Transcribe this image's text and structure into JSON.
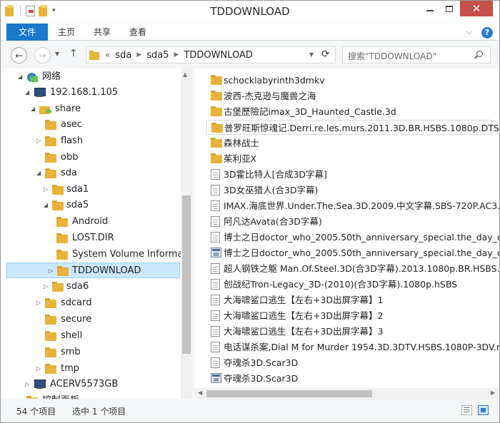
{
  "window": {
    "title": "TDDOWNLOAD"
  },
  "ribbon": {
    "tabs": [
      "文件",
      "主页",
      "共享",
      "查看"
    ],
    "help": "?"
  },
  "nav": {
    "back": "←",
    "forward": "→",
    "up": "↑",
    "breadcrumb_more": "«",
    "breadcrumb": [
      "sda",
      "sda5",
      "TDDOWNLOAD"
    ],
    "refresh": "⟳",
    "search_placeholder": "搜索\"TDDOWNLOAD\""
  },
  "tree": {
    "items": [
      {
        "label": "网络",
        "icon": "network-icon"
      },
      {
        "label": "192.168.1.105",
        "icon": "computer-icon"
      },
      {
        "label": "share",
        "icon": "shared-folder-icon"
      },
      {
        "label": "asec",
        "icon": "folder-icon"
      },
      {
        "label": "flash",
        "icon": "folder-icon"
      },
      {
        "label": "obb",
        "icon": "folder-icon"
      },
      {
        "label": "sda",
        "icon": "folder-icon"
      },
      {
        "label": "sda1",
        "icon": "folder-icon"
      },
      {
        "label": "sda5",
        "icon": "folder-icon"
      },
      {
        "label": "Android",
        "icon": "folder-icon"
      },
      {
        "label": "LOST.DIR",
        "icon": "folder-icon"
      },
      {
        "label": "System Volume Informat",
        "icon": "folder-icon"
      },
      {
        "label": "TDDOWNLOAD",
        "icon": "folder-icon",
        "selected": true
      },
      {
        "label": "sda6",
        "icon": "folder-icon"
      },
      {
        "label": "sdcard",
        "icon": "folder-icon"
      },
      {
        "label": "secure",
        "icon": "folder-icon"
      },
      {
        "label": "shell",
        "icon": "folder-icon"
      },
      {
        "label": "smb",
        "icon": "folder-icon"
      },
      {
        "label": "tmp",
        "icon": "folder-icon"
      },
      {
        "label": "ACERV5573GB",
        "icon": "computer-icon"
      },
      {
        "label": "控制面板",
        "icon": "folder-icon"
      }
    ]
  },
  "files": [
    {
      "name": "schocklabyrinth3dmkv",
      "type": "folder"
    },
    {
      "name": "波西-杰克逊与魔兽之海",
      "type": "folder"
    },
    {
      "name": "古堡歷險記imax_3D_Haunted_Castle.3d",
      "type": "folder"
    },
    {
      "name": "普罗旺斯惊魂记.Derri.re.les.murs.2011.3D.BR.HSBS.1080p.DTS",
      "type": "folder",
      "hover": true
    },
    {
      "name": "森林战士",
      "type": "folder"
    },
    {
      "name": "茱利亚X",
      "type": "folder"
    },
    {
      "name": "3D霍比特人[合成3D字幕]",
      "type": "file"
    },
    {
      "name": "3D女巫猎人(合3D字幕)",
      "type": "file"
    },
    {
      "name": "IMAX.海底世界.Under.The.Sea.3D.2009.中文字幕.SBS-720P.AC3.",
      "type": "file"
    },
    {
      "name": "阿凡达Avata(合3D字幕)",
      "type": "file"
    },
    {
      "name": "博士之日doctor_who_2005.50th_anniversary_special.the_day_of",
      "type": "file"
    },
    {
      "name": "博士之日doctor_who_2005.50th_anniversary_special.the_day_of",
      "type": "video"
    },
    {
      "name": "超人钢铁之躯 Man.Of.Steel.3D(合3D字幕).2013.1080p.BR.HSBS.D",
      "type": "file"
    },
    {
      "name": "创战纪Tron-Legacy_3D-(2010)(合3D字幕).1080p.hSBS",
      "type": "file"
    },
    {
      "name": "大海啸鲨口逃生【左右+3D出屏字幕】1",
      "type": "file"
    },
    {
      "name": "大海啸鲨口逃生【左右+3D出屏字幕】2",
      "type": "file"
    },
    {
      "name": "大海啸鲨口逃生【左右+3D出屏字幕】3",
      "type": "file"
    },
    {
      "name": "电话谋杀案,Dial M for Murder 1954.3D.3DTV.HSBS.1080P-3DV.r",
      "type": "file"
    },
    {
      "name": "夺魂杀3D.Scar3D",
      "type": "file"
    },
    {
      "name": "夺魂杀3D.Scar3D",
      "type": "video"
    }
  ],
  "status": {
    "count": "54 个项目",
    "selected": "选中 1 个项目"
  }
}
